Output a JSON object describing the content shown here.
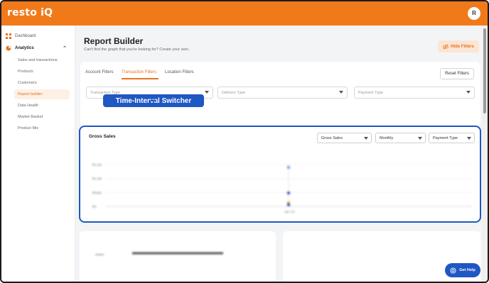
{
  "app": {
    "logo": "resto iQ",
    "avatar_initial": "R"
  },
  "sidebar": {
    "dashboard": "Dashboard",
    "analytics": "Analytics",
    "items": [
      {
        "label": "Sales and transactions"
      },
      {
        "label": "Products"
      },
      {
        "label": "Customers"
      },
      {
        "label": "Report builder"
      },
      {
        "label": "Data Health"
      },
      {
        "label": "Market Basket"
      },
      {
        "label": "Product Mix"
      }
    ]
  },
  "header": {
    "title": "Report Builder",
    "subtitle": "Can't find the graph that you're looking for? Create your own.",
    "hide_filters": "Hide Filters"
  },
  "filters": {
    "tabs": [
      "Account Filters",
      "Transaction Filters",
      "Location Filters"
    ],
    "reset": "Reset Filters",
    "selects": [
      "Transaction Type",
      "Delivery Type",
      "Payment Type"
    ]
  },
  "callout": "Time-Interval Switcher",
  "chart_card": {
    "title": "Gross Sales",
    "selects": [
      "Gross Sales",
      "Monthly",
      "Payment Type"
    ]
  },
  "chart_data": {
    "type": "scatter",
    "title": "Gross Sales",
    "y_ticks": [
      "₱1.5M",
      "₱1.0M",
      "₱500k",
      "₱0"
    ],
    "x_ticks": [
      "Jan '23"
    ],
    "points": [
      {
        "x": "Jan '23",
        "y": 1400000,
        "color": "#7aa0e6"
      },
      {
        "x": "Jan '23",
        "y": 480000,
        "color": "#3a55c6"
      },
      {
        "x": "Jan '23",
        "y": 130000,
        "color": "#e8b23a"
      },
      {
        "x": "Jan '23",
        "y": 60000,
        "color": "#3a55c6"
      }
    ]
  },
  "help": {
    "label": "Get Help"
  },
  "colors": {
    "brand": "#f07a1a",
    "accent_blue": "#1f57c3"
  }
}
